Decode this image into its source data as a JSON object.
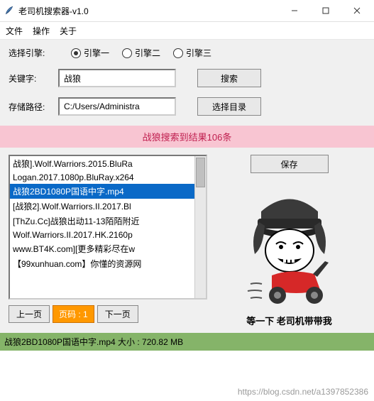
{
  "window": {
    "title": "老司机搜索器-v1.0"
  },
  "menu": {
    "file": "文件",
    "op": "操作",
    "about": "关于"
  },
  "engine": {
    "label": "选择引擎:",
    "opt1": "引擎一",
    "opt2": "引擎二",
    "opt3": "引擎三"
  },
  "keyword": {
    "label": "关键字:",
    "value": "战狼",
    "search_btn": "搜索"
  },
  "path": {
    "label": "存储路径:",
    "value": "C:/Users/Administra",
    "browse_btn": "选择目录"
  },
  "result_banner": "战狼搜索到结果106条",
  "list": [
    "战狼].Wolf.Warriors.2015.BluRa",
    "Logan.2017.1080p.BluRay.x264",
    "战狼2BD1080P国语中字.mp4",
    "[战狼2].Wolf.Warriors.II.2017.Bl",
    "[ThZu.Cc]战狼出动11-13陌陌附近",
    "Wolf.Warriors.II.2017.HK.2160p",
    "www.BT4K.com][更多精彩尽在w",
    "【99xunhuan.com】你懂的资源网"
  ],
  "selected_index": 2,
  "pager": {
    "prev": "上一页",
    "page_label": "页码 : 1",
    "next": "下一页"
  },
  "save_btn": "保存",
  "caption": "等一下 老司机带带我",
  "statusbar": "战狼2BD1080P国语中字.mp4 大小 : 720.82 MB",
  "watermark": "https://blog.csdn.net/a1397852386"
}
